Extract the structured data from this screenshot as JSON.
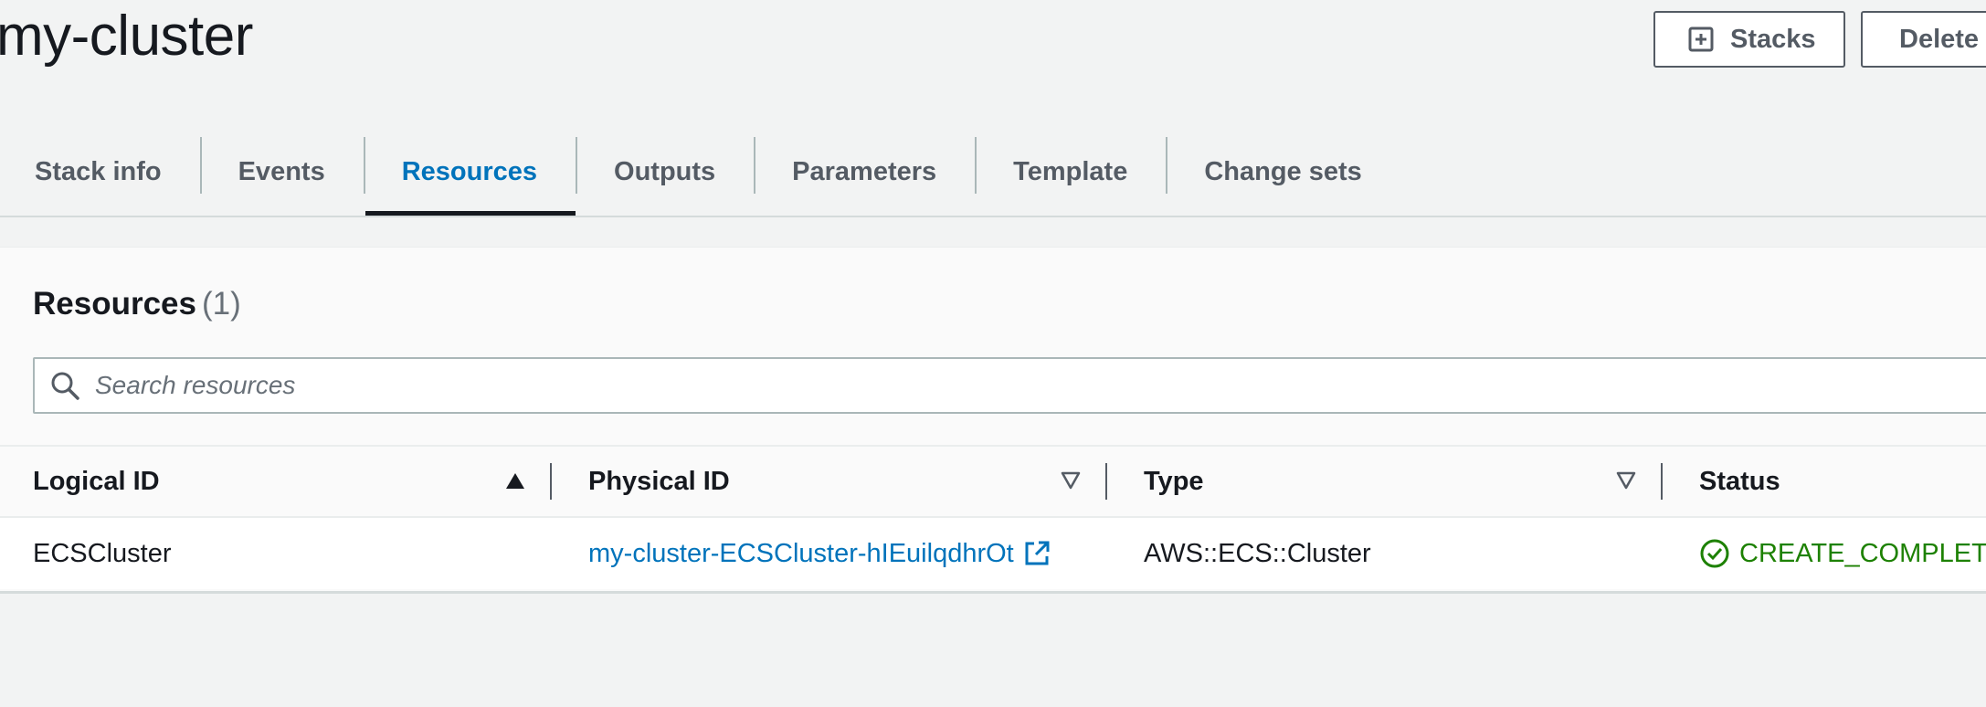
{
  "header": {
    "title": "my-cluster",
    "stacks_button": "Stacks",
    "delete_button": "Delete"
  },
  "tabs": [
    {
      "label": "Stack info",
      "active": false
    },
    {
      "label": "Events",
      "active": false
    },
    {
      "label": "Resources",
      "active": true
    },
    {
      "label": "Outputs",
      "active": false
    },
    {
      "label": "Parameters",
      "active": false
    },
    {
      "label": "Template",
      "active": false
    },
    {
      "label": "Change sets",
      "active": false
    }
  ],
  "resources": {
    "title": "Resources",
    "count": "(1)",
    "search_placeholder": "Search resources",
    "search_value": "",
    "columns": {
      "logical_id": "Logical ID",
      "physical_id": "Physical ID",
      "type": "Type",
      "status": "Status"
    },
    "rows": [
      {
        "logical_id": "ECSCluster",
        "physical_id": "my-cluster-ECSCluster-hIEuilqdhrOt",
        "type": "AWS::ECS::Cluster",
        "status": "CREATE_COMPLETE"
      }
    ]
  },
  "colors": {
    "accent": "#0073bb",
    "success": "#1d8102",
    "background": "#f2f3f3"
  },
  "icons": {
    "stacks_button": "add-plus-square-icon",
    "search": "search-icon",
    "sort_ascending": "sort-ascending-icon",
    "sort": "sort-descending-outline-icon",
    "external": "external-link-icon",
    "status": "status-success-icon"
  }
}
